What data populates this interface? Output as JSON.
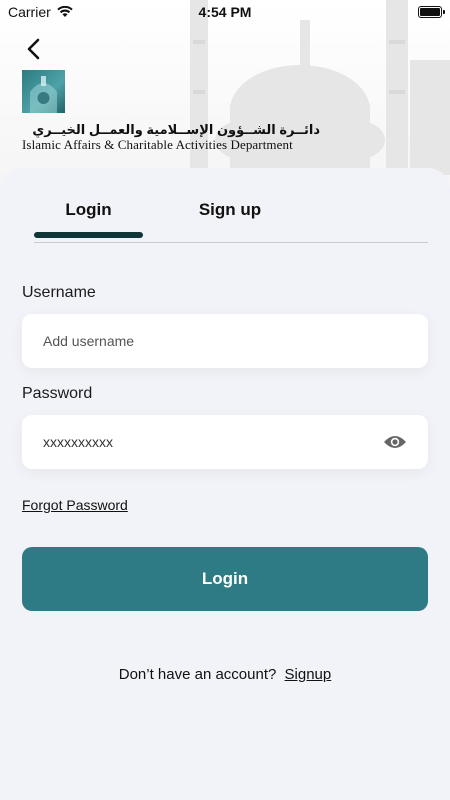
{
  "status_bar": {
    "carrier": "Carrier",
    "time": "4:54 PM",
    "wifi_icon": "wifi-icon",
    "battery_icon": "battery-icon"
  },
  "header": {
    "back_icon": "chevron-left-icon",
    "logo_arabic": "دائــرة الشــؤون الإســلامية والعمــل الخيــري",
    "logo_english": "Islamic Affairs & Charitable Activities Department"
  },
  "tabs": [
    {
      "label": "Login",
      "active": true
    },
    {
      "label": "Sign up",
      "active": false
    }
  ],
  "form": {
    "username_label": "Username",
    "username_placeholder": "Add username",
    "username_value": "",
    "password_label": "Password",
    "password_value": "xxxxxxxxxx",
    "eye_icon": "eye-icon",
    "forgot_label": "Forgot Password",
    "submit_label": "Login"
  },
  "footer": {
    "prompt": "Don’t have an account?",
    "signup_label": "Signup"
  },
  "colors": {
    "accent": "#2e7a85",
    "tab_indicator": "#0f3538",
    "background": "#f2f3f8"
  }
}
